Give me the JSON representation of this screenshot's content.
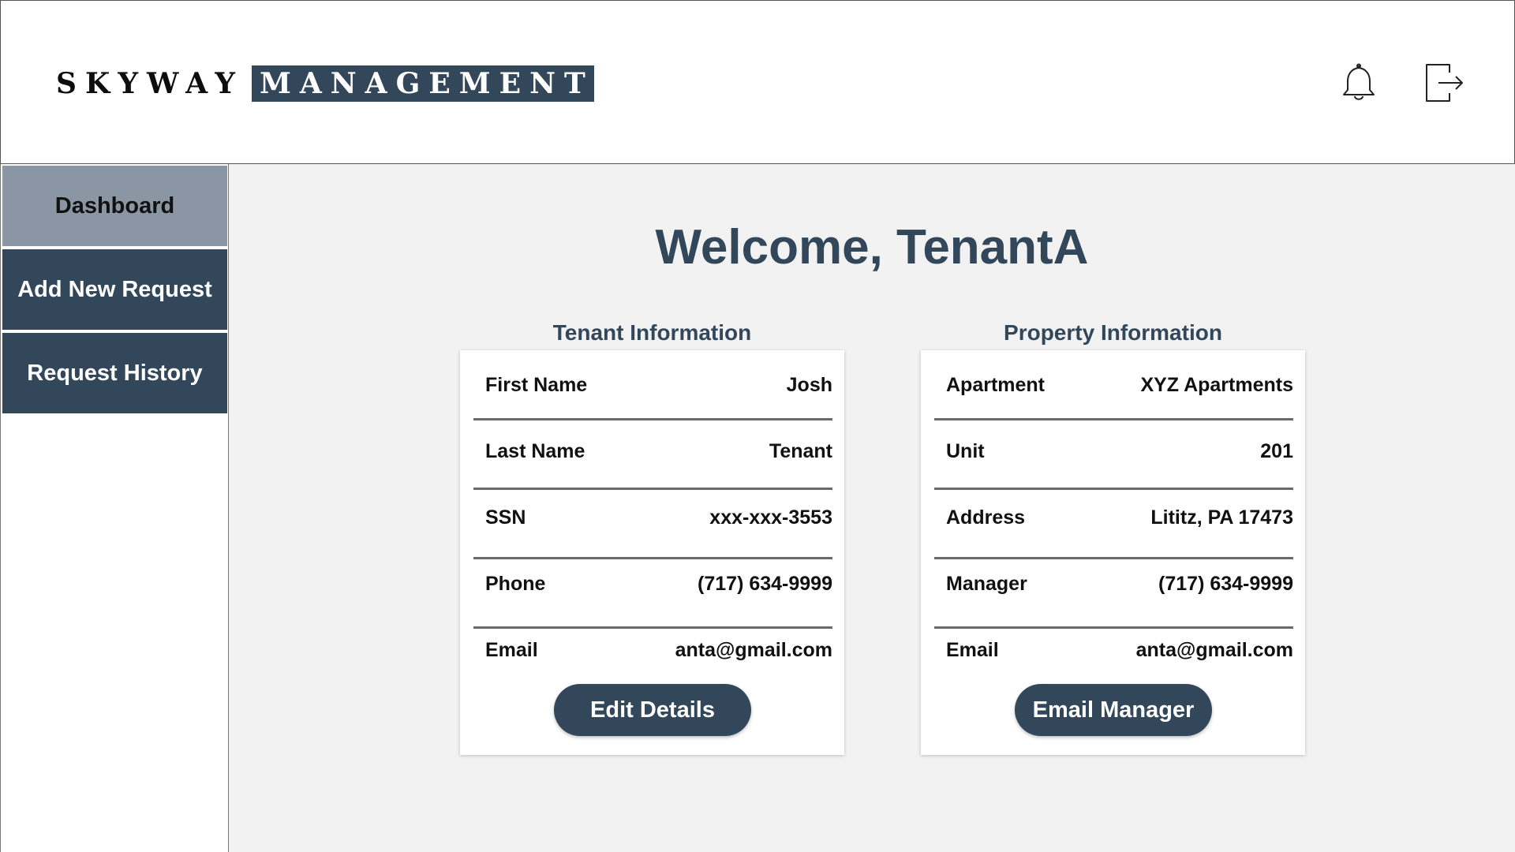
{
  "header": {
    "logo_word1": "SKYWAY",
    "logo_word2": "MANAGEMENT",
    "notifications_icon": "bell-icon",
    "logout_icon": "logout-icon"
  },
  "sidebar": {
    "items": [
      {
        "label": "Dashboard",
        "active": true
      },
      {
        "label": "Add New Request",
        "active": false
      },
      {
        "label": "Request History",
        "active": false
      }
    ]
  },
  "main": {
    "welcome": "Welcome, TenantA",
    "tenant": {
      "title": "Tenant Information",
      "rows": [
        {
          "label": "First Name",
          "value": "Josh"
        },
        {
          "label": "Last Name",
          "value": "Tenant"
        },
        {
          "label": "SSN",
          "value": "xxx-xxx-3553"
        },
        {
          "label": "Phone",
          "value": "(717) 634-9999"
        },
        {
          "label": "Email",
          "value": "anta@gmail.com"
        }
      ],
      "button": "Edit Details"
    },
    "property": {
      "title": "Property Information",
      "rows": [
        {
          "label": "Apartment",
          "value": "XYZ Apartments"
        },
        {
          "label": "Unit",
          "value": "201"
        },
        {
          "label": "Address",
          "value": "Lititz, PA 17473"
        },
        {
          "label": "Manager",
          "value": "(717) 634-9999"
        },
        {
          "label": "Email",
          "value": "anta@gmail.com"
        }
      ],
      "button": "Email Manager"
    }
  },
  "colors": {
    "primary": "#33475b",
    "active_nav": "#8a96a3",
    "background": "#f2f2f2"
  }
}
